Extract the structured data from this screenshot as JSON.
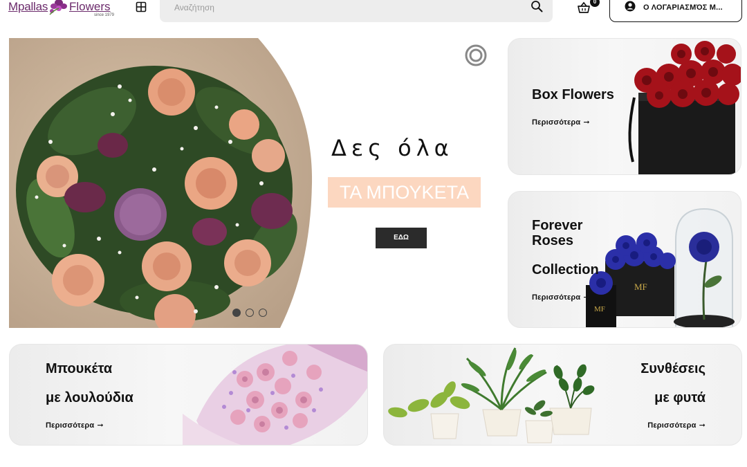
{
  "header": {
    "logo": {
      "word1": "Mpallas",
      "word2": "Flowers",
      "since": "since 1979"
    },
    "search_placeholder": "Αναζήτηση",
    "cart_count": "0",
    "account_label": "Ο ΛΟΓΑΡΙΑΣΜΌΣ Μ..."
  },
  "hero": {
    "title": "Δες όλα",
    "subtitle": "ΤΑ ΜΠΟΥΚΕΤΑ",
    "button_label": "ΕΔΩ",
    "slides": 3,
    "active_slide": 1
  },
  "cards": {
    "box": {
      "title": "Box Flowers",
      "more": "Περισσότερα"
    },
    "forever": {
      "title_line1": "Forever",
      "title_line2": "Roses",
      "title_line3": "Collection",
      "more": "Περισσότερα"
    },
    "bouquet": {
      "title_line1": "Μπουκέτα",
      "title_line2": "με λουλούδια",
      "more": "Περισσότερα"
    },
    "plants": {
      "title_line1": "Συνθέσεις",
      "title_line2": "με φυτά",
      "more": "Περισσότερα"
    },
    "arrow": "➞"
  },
  "colors": {
    "brand": "#6b2a6b",
    "hero_subtitle_bg": "#fcd7c0",
    "button_dark": "#2b2b2b",
    "search_bg": "#ededed"
  }
}
